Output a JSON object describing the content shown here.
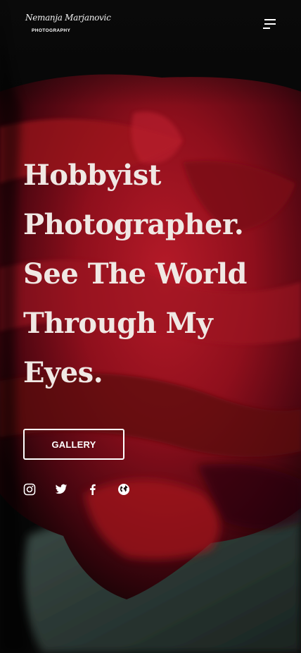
{
  "header": {
    "logo_script": "Nemanja Marjanovic",
    "logo_sub": "PHOTOGRAPHY",
    "menu_icon": "hamburger-menu-icon"
  },
  "hero": {
    "title_lines": [
      "Hobbyist",
      "Photographer.",
      "See The World",
      "Through My",
      "Eyes."
    ],
    "cta_label": "GALLERY"
  },
  "social": [
    {
      "icon": "instagram-icon"
    },
    {
      "icon": "twitter-icon"
    },
    {
      "icon": "facebook-icon"
    },
    {
      "icon": "globe-icon"
    }
  ],
  "colors": {
    "background": "#070707",
    "rose": "#8e0f1c",
    "text": "#f0e8e4"
  }
}
